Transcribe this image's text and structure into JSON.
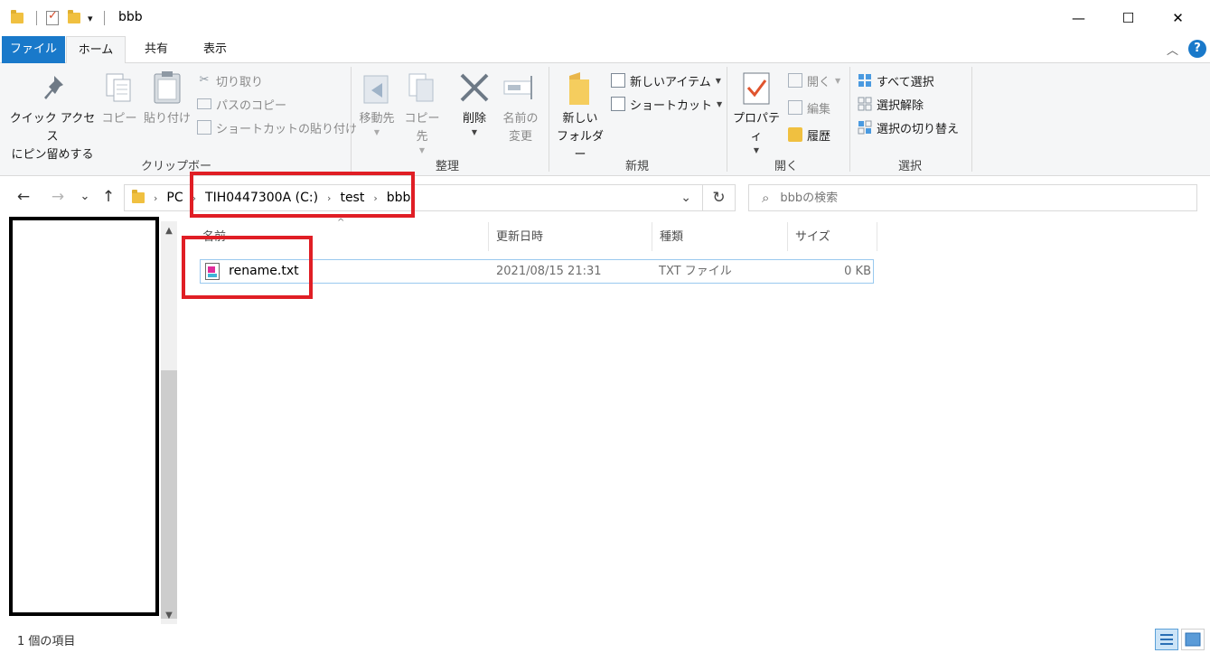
{
  "window": {
    "title": "bbb",
    "quick_access_dropdown": "▾",
    "minimize": "—",
    "maximize": "☐",
    "close": "✕"
  },
  "ribbon_tabs": [
    {
      "label": "ファイル"
    },
    {
      "label": "ホーム"
    },
    {
      "label": "共有"
    },
    {
      "label": "表示"
    }
  ],
  "ribbon": {
    "collapse": "︿",
    "help": "?",
    "clipboard": {
      "pin_line1": "クイック アクセス",
      "pin_line2": "にピン留めする",
      "copy": "コピー",
      "paste": "貼り付け",
      "cut": "切り取り",
      "copy_path": "パスのコピー",
      "paste_shortcut": "ショートカットの貼り付け",
      "group": "クリップボード"
    },
    "organize": {
      "move_to": "移動先",
      "copy_to": "コピー先",
      "delete": "削除",
      "rename_line1": "名前の",
      "rename_line2": "変更",
      "group": "整理"
    },
    "new": {
      "new_folder_line1": "新しい",
      "new_folder_line2": "フォルダー",
      "new_item": "新しいアイテム",
      "shortcut": "ショートカット",
      "group": "新規"
    },
    "open": {
      "properties": "プロパティ",
      "open": "開く",
      "edit": "編集",
      "history": "履歴",
      "group": "開く"
    },
    "select": {
      "select_all": "すべて選択",
      "select_none": "選択解除",
      "invert": "選択の切り替え",
      "group": "選択"
    }
  },
  "nav": {
    "back": "←",
    "forward": "→",
    "recent": "⌄",
    "up": "↑",
    "breadcrumb": [
      "PC",
      "TIH0447300A (C:)",
      "test",
      "bbb"
    ],
    "crumb_sep": "›",
    "dropdown": "⌄",
    "refresh": "↻",
    "search_placeholder": "bbbの検索",
    "search_icon": "⌕"
  },
  "file_list": {
    "sort_caret": "^",
    "columns": [
      "名前",
      "更新日時",
      "種類",
      "サイズ"
    ],
    "rows": [
      {
        "name": "rename.txt",
        "modified": "2021/08/15 21:31",
        "type": "TXT ファイル",
        "size": "0 KB"
      }
    ]
  },
  "status_bar": {
    "count": "1 個の項目"
  },
  "colors": {
    "accent": "#1979ca",
    "annotation_red": "#e01e25",
    "ribbon_bg": "#f5f6f7"
  }
}
